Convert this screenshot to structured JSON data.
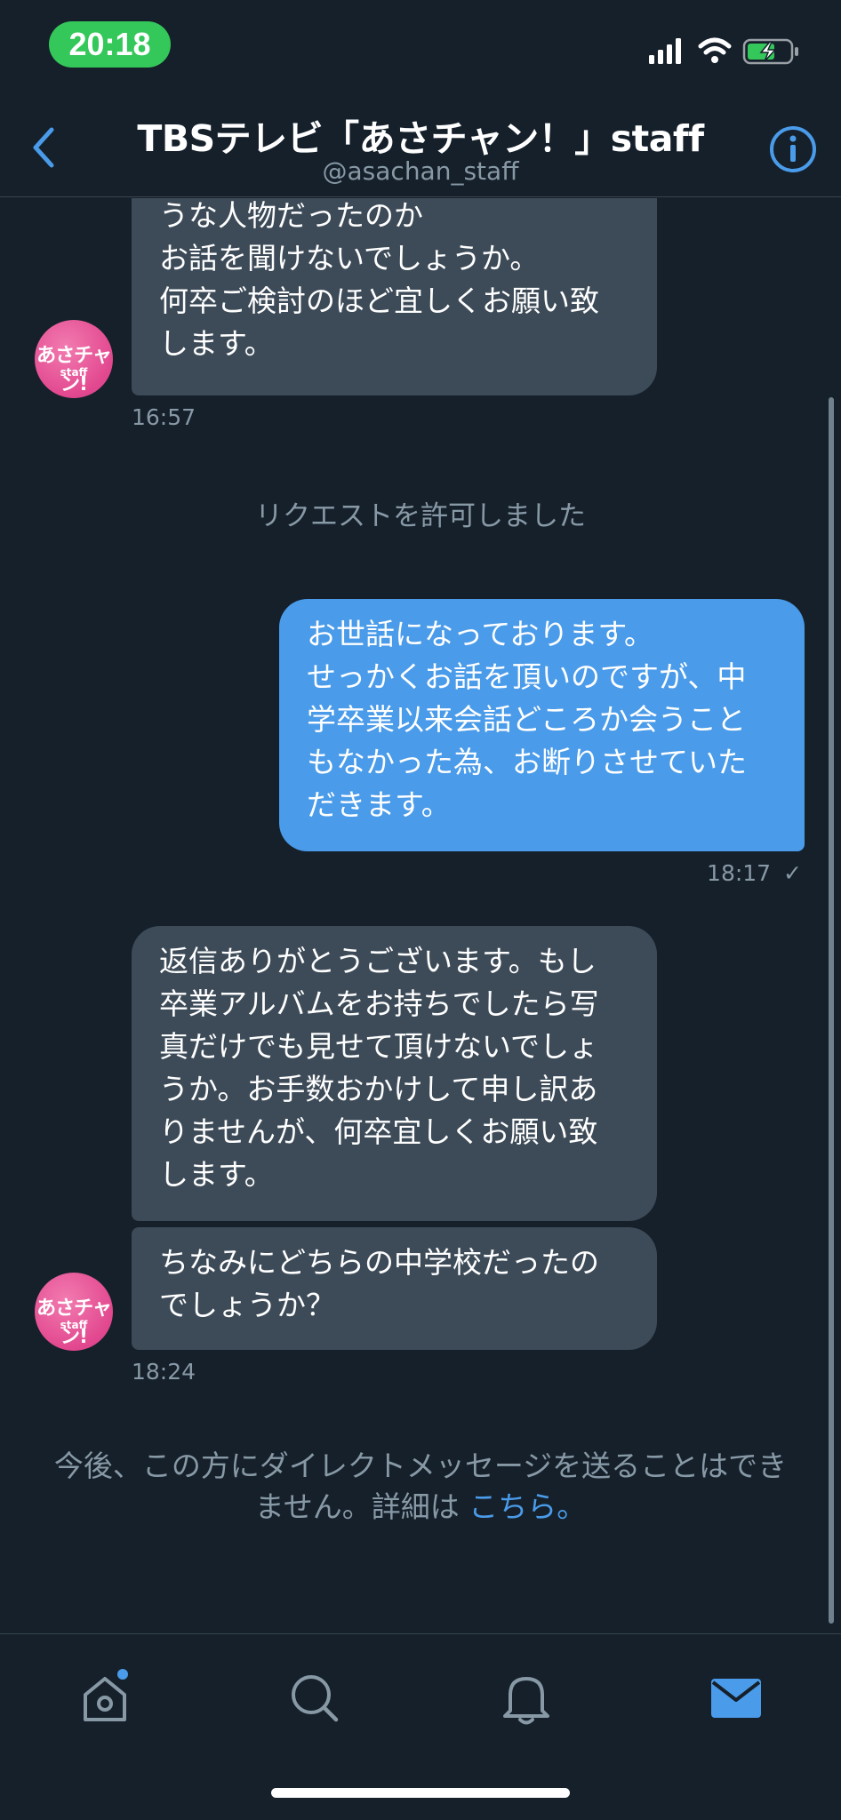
{
  "status_bar": {
    "time": "20:18"
  },
  "header": {
    "title": "TBSテレビ「あさチャン！」staff",
    "handle": "@asachan_staff"
  },
  "avatar": {
    "logo_text": "あさチャン!",
    "logo_sub": "staff"
  },
  "messages": [
    {
      "id": "m1",
      "direction": "incoming",
      "text": "うな人物だったのか\nお話を聞けないでしょうか。\n何卒ご検討のほど宜しくお願い致\nします。"
    },
    {
      "id": "m2",
      "direction": "outgoing",
      "text": "お世話になっております。\nせっかくお話を頂いのですが、中\n学卒業以来会話どころか会うこと\nもなかった為、お断りさせていた\nだきます。"
    },
    {
      "id": "m3",
      "direction": "incoming",
      "text": "返信ありがとうございます。もし\n卒業アルバムをお持ちでしたら写\n真だけでも見せて頂けないでしょ\nうか。お手数おかけして申し訳あ\nりませんが、何卒宜しくお願い致\nします。"
    },
    {
      "id": "m4",
      "direction": "incoming",
      "text": "ちなみにどちらの中学校だったの\nでしょうか？"
    }
  ],
  "timestamps": {
    "t1": "16:57",
    "t2": "18:17",
    "t3": "18:24"
  },
  "read_mark": "✓",
  "system_note": "リクエストを許可しました",
  "notice": {
    "text": "今後、この方にダイレクトメッセージを送ることはでき\nません。詳細は ",
    "link": "こちら",
    "suffix": "。"
  },
  "tabs": [
    "home",
    "search",
    "notifications",
    "messages"
  ],
  "colors": {
    "background": "#15202b",
    "incoming_bubble": "#3d4b58",
    "outgoing_bubble": "#4a9be9",
    "accent": "#4a9be9",
    "muted_text": "#8899a6",
    "status_pill": "#34c759"
  }
}
